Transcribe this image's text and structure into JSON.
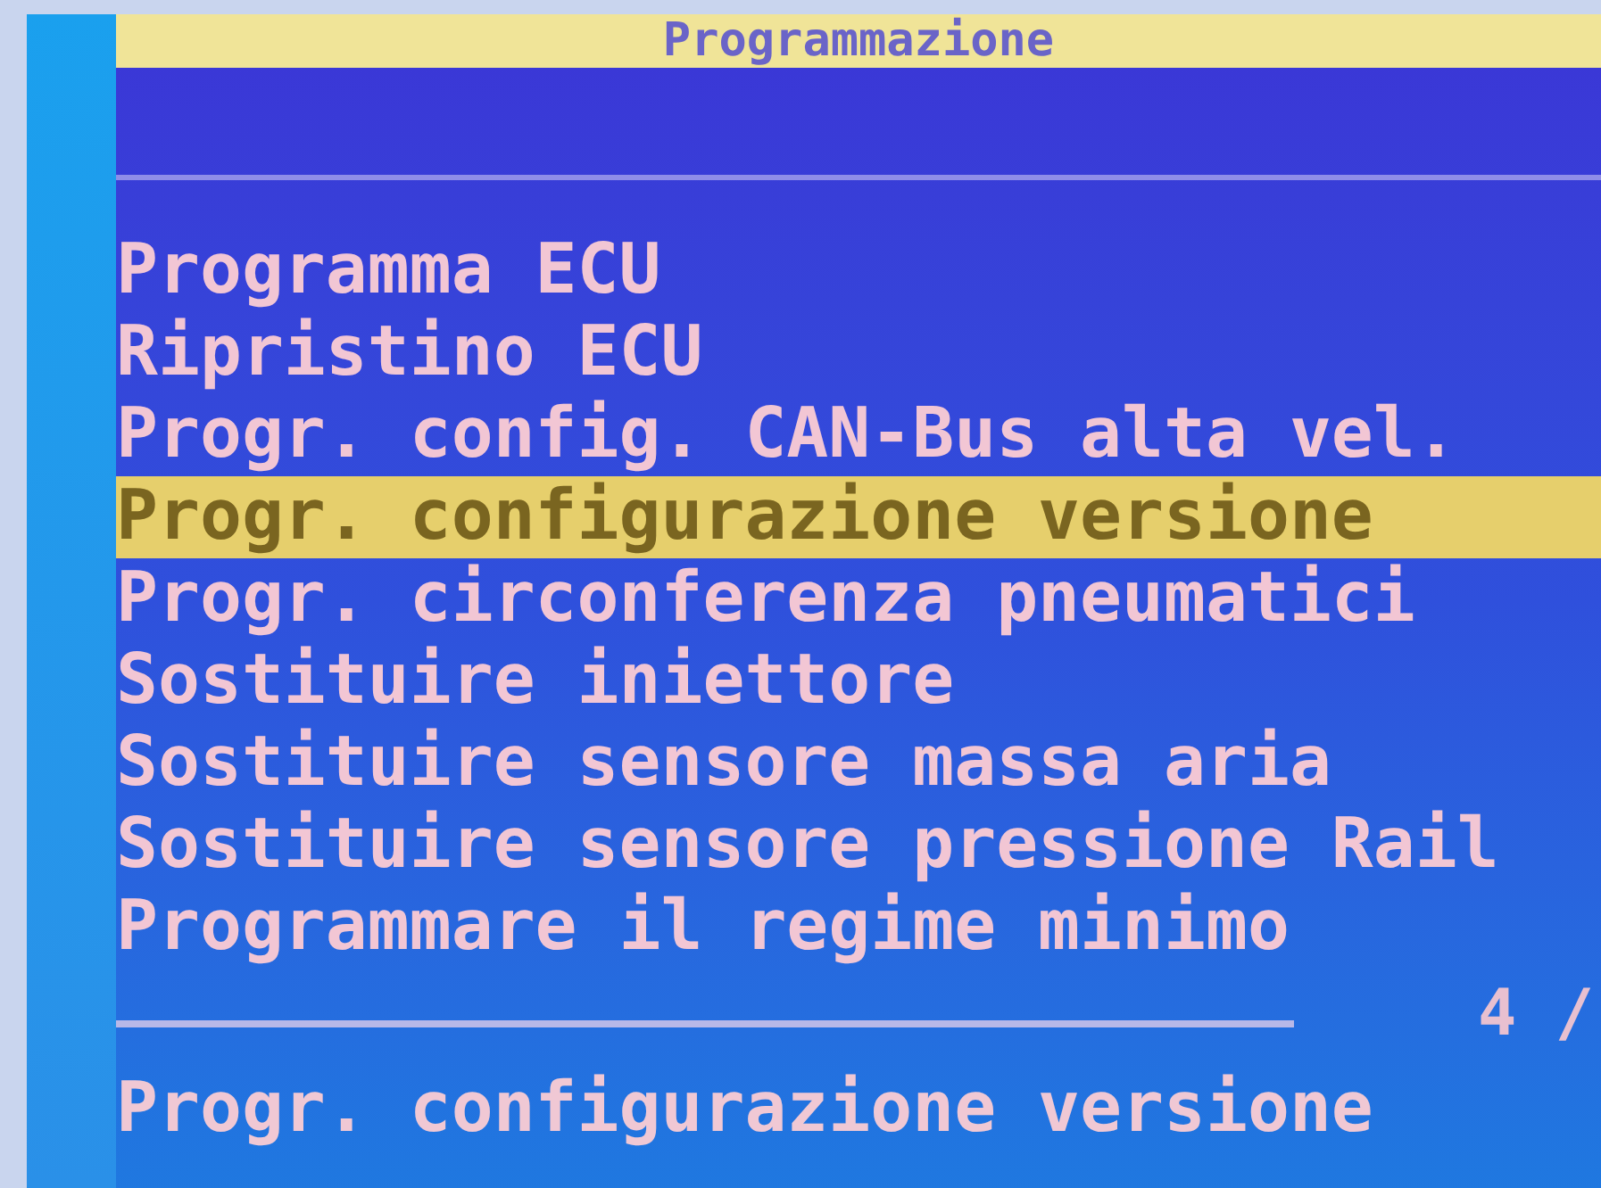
{
  "header": {
    "title": "Programmazione"
  },
  "menu": {
    "items": [
      {
        "label": "Programma ECU",
        "selected": false
      },
      {
        "label": "Ripristino ECU",
        "selected": false
      },
      {
        "label": "Progr. config. CAN-Bus alta vel.",
        "selected": false
      },
      {
        "label": "Progr. configurazione versione",
        "selected": true
      },
      {
        "label": "Progr. circonferenza pneumatici",
        "selected": false
      },
      {
        "label": "Sostituire iniettore",
        "selected": false
      },
      {
        "label": "Sostituire sensore massa aria",
        "selected": false
      },
      {
        "label": "Sostituire sensore pressione Rail",
        "selected": false
      },
      {
        "label": "Programmare il regime minimo",
        "selected": false
      }
    ]
  },
  "page_indicator": "4 /",
  "status_line": "Progr. configurazione versione"
}
